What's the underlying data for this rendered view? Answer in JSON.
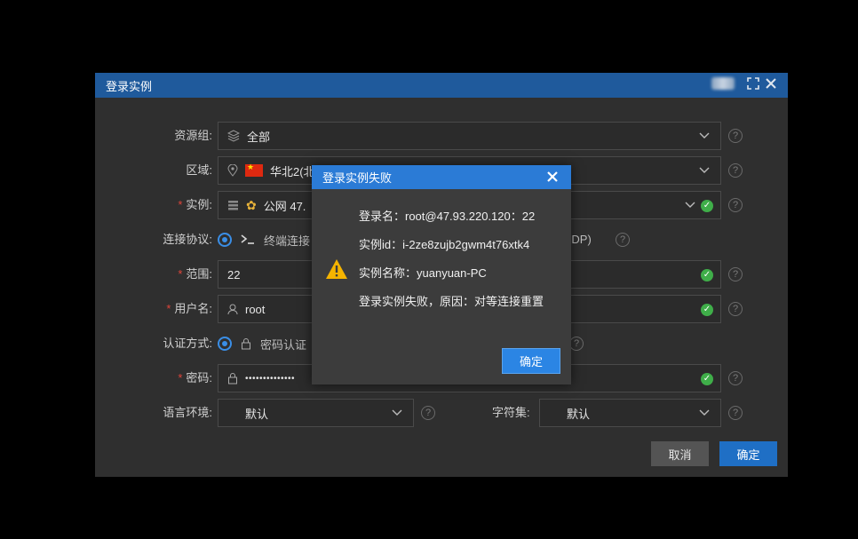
{
  "modal": {
    "title": "登录实例",
    "fields": {
      "resource_group": {
        "label": "资源组:",
        "value": "全部"
      },
      "region": {
        "label": "区域:",
        "value": "华北2(北"
      },
      "instance": {
        "label": "实例:",
        "value": "公网  47."
      },
      "protocol": {
        "label": "连接协议:",
        "option1": "终端连接",
        "option2_tail": "RDP)"
      },
      "port": {
        "label": "范围:",
        "value": "22"
      },
      "username": {
        "label": "用户名:",
        "value": "root"
      },
      "auth": {
        "label": "认证方式:",
        "option1": "密码认证"
      },
      "password": {
        "label": "密码:",
        "value": "••••••••••••••"
      },
      "language": {
        "label": "语言环境:",
        "value": "默认"
      },
      "charset": {
        "label": "字符集:",
        "value": "默认"
      }
    },
    "buttons": {
      "cancel": "取消",
      "confirm": "确定"
    },
    "help_glyph": "?",
    "required_mark": "*"
  },
  "alert": {
    "title": "登录实例失败",
    "lines": [
      "登录名：root@47.93.220.120：22",
      "实例id：i-2ze8zujb2gwm4t76xtk4",
      "实例名称：yuanyuan-PC",
      "登录实例失败，原因：对等连接重置"
    ],
    "ok_label": "确定"
  },
  "colors": {
    "header_blue": "#1f5a9c",
    "alert_header_blue": "#2b7bd6",
    "primary_button": "#1f6fc5",
    "warning_yellow": "#f5b400",
    "success_green": "#3fae49"
  },
  "icons": [
    "fullscreen-icon",
    "close-icon",
    "layers-icon",
    "location-icon",
    "flag-cn-icon",
    "server-icon",
    "terminal-icon",
    "user-icon",
    "lock-icon",
    "chevron-down-icon",
    "check-circle-icon",
    "help-icon",
    "warning-icon"
  ]
}
